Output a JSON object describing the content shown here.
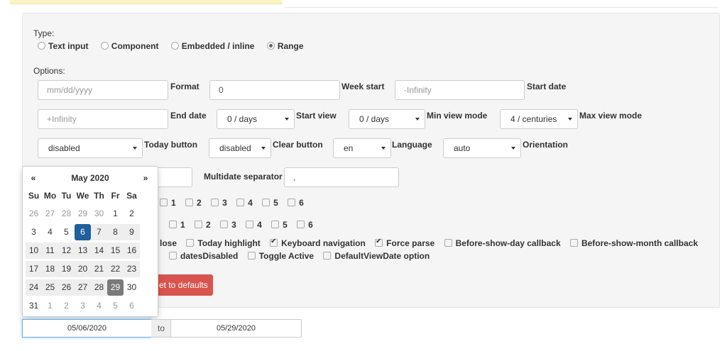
{
  "type_section": {
    "label": "Type:",
    "options": [
      "Text input",
      "Component",
      "Embedded / inline",
      "Range"
    ],
    "selected": "Range"
  },
  "options_section": {
    "label": "Options:",
    "format": {
      "placeholder": "mm/dd/yyyy",
      "label": "Format"
    },
    "week_start": {
      "value": "0",
      "label": "Week start"
    },
    "start_date": {
      "value": "-Infinity",
      "label": "Start date"
    },
    "end_date": {
      "value": "+Infinity",
      "label": "End date"
    },
    "start_view": {
      "value": "0 / days",
      "label": "Start view"
    },
    "min_view_mode": {
      "value": "0 / days",
      "label": "Min view mode"
    },
    "max_view_mode": {
      "value": "4 / centuries",
      "label": "Max view mode"
    },
    "today_button": {
      "value": "disabled",
      "label": "Today button"
    },
    "clear_button": {
      "value": "disabled",
      "label": "Clear button"
    },
    "language": {
      "value": "en",
      "label": "Language"
    },
    "orientation": {
      "value": "auto",
      "label": "Orientation"
    },
    "multidate_separator": {
      "value": ",",
      "label": "Multidate separator"
    }
  },
  "days_of_week_row1": [
    "1",
    "2",
    "3",
    "4",
    "5",
    "6"
  ],
  "days_of_week_row2": [
    "1",
    "2",
    "3",
    "4",
    "5",
    "6"
  ],
  "checkboxes_row1": [
    {
      "label": "lose",
      "checked": false
    },
    {
      "label": "Today highlight",
      "checked": false
    },
    {
      "label": "Keyboard navigation",
      "checked": true
    },
    {
      "label": "Force parse",
      "checked": true
    },
    {
      "label": "Before-show-day callback",
      "checked": false
    },
    {
      "label": "Before-show-month callback",
      "checked": false
    }
  ],
  "checkboxes_row2": [
    {
      "label": "datesDisabled",
      "checked": false
    },
    {
      "label": "Toggle Active",
      "checked": false
    },
    {
      "label": "DefaultViewDate option",
      "checked": false
    }
  ],
  "reset_button": "et to defaults",
  "calendar": {
    "prev": "«",
    "next": "»",
    "title": "May 2020",
    "dow": [
      "Su",
      "Mo",
      "Tu",
      "We",
      "Th",
      "Fr",
      "Sa"
    ],
    "weeks": [
      [
        "26",
        "27",
        "28",
        "29",
        "30",
        "1",
        "2"
      ],
      [
        "3",
        "4",
        "5",
        "6",
        "7",
        "8",
        "9"
      ],
      [
        "10",
        "11",
        "12",
        "13",
        "14",
        "15",
        "16"
      ],
      [
        "17",
        "18",
        "19",
        "20",
        "21",
        "22",
        "23"
      ],
      [
        "24",
        "25",
        "26",
        "27",
        "28",
        "29",
        "30"
      ],
      [
        "31",
        "1",
        "2",
        "3",
        "4",
        "5",
        "6"
      ]
    ]
  },
  "range": {
    "start": "05/06/2020",
    "separator": "to",
    "end": "05/29/2020"
  },
  "colors": {
    "selected_start": "#1f5f9c",
    "selected_end": "#7a7a7a",
    "reset_button": "#d9534f"
  }
}
